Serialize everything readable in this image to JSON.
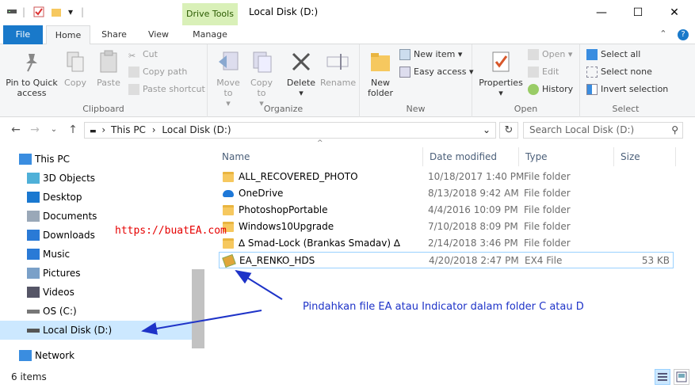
{
  "title_bar": {
    "contextual_tab": "Drive Tools",
    "window_title": "Local Disk (D:)",
    "minimize": "—",
    "maximize": "☐",
    "close": "✕"
  },
  "tabs": {
    "file": "File",
    "home": "Home",
    "share": "Share",
    "view": "View",
    "manage": "Manage"
  },
  "ribbon": {
    "clipboard": {
      "label": "Clipboard",
      "pin": "Pin to Quick access",
      "copy": "Copy",
      "paste": "Paste",
      "cut": "Cut",
      "copy_path": "Copy path",
      "paste_shortcut": "Paste shortcut"
    },
    "organize": {
      "label": "Organize",
      "move_to": "Move to",
      "copy_to": "Copy to",
      "delete": "Delete",
      "rename": "Rename"
    },
    "new": {
      "label": "New",
      "new_folder": "New folder",
      "new_item": "New item",
      "easy_access": "Easy access"
    },
    "open": {
      "label": "Open",
      "properties": "Properties",
      "open": "Open",
      "edit": "Edit",
      "history": "History"
    },
    "select": {
      "label": "Select",
      "select_all": "Select all",
      "select_none": "Select none",
      "invert_selection": "Invert selection"
    }
  },
  "address": {
    "crumbs": [
      "This PC",
      "Local Disk (D:)"
    ],
    "search_placeholder": "Search Local Disk (D:)"
  },
  "nav": {
    "items": [
      {
        "label": "This PC",
        "icon": "pc-icon"
      },
      {
        "label": "3D Objects",
        "icon": "cube-icon"
      },
      {
        "label": "Desktop",
        "icon": "desktop-icon"
      },
      {
        "label": "Documents",
        "icon": "documents-icon"
      },
      {
        "label": "Downloads",
        "icon": "downloads-icon"
      },
      {
        "label": "Music",
        "icon": "music-icon"
      },
      {
        "label": "Pictures",
        "icon": "pictures-icon"
      },
      {
        "label": "Videos",
        "icon": "videos-icon"
      },
      {
        "label": "OS (C:)",
        "icon": "drive-c-icon"
      },
      {
        "label": "Local Disk (D:)",
        "icon": "drive-d-icon"
      },
      {
        "label": "Network",
        "icon": "network-icon"
      }
    ]
  },
  "columns": {
    "name": "Name",
    "date": "Date modified",
    "type": "Type",
    "size": "Size"
  },
  "files": [
    {
      "name": "ALL_RECOVERED_PHOTO",
      "date": "10/18/2017 1:40 PM",
      "type": "File folder",
      "size": "",
      "icon": "folder-icon"
    },
    {
      "name": "OneDrive",
      "date": "8/13/2018 9:42 AM",
      "type": "File folder",
      "size": "",
      "icon": "onedrive-icon"
    },
    {
      "name": "PhotoshopPortable",
      "date": "4/4/2016 10:09 PM",
      "type": "File folder",
      "size": "",
      "icon": "folder-icon"
    },
    {
      "name": "Windows10Upgrade",
      "date": "7/10/2018 8:09 PM",
      "type": "File folder",
      "size": "",
      "icon": "folder-icon"
    },
    {
      "name": "∆ Smad-Lock (Brankas Smadav) ∆",
      "date": "2/14/2018 3:46 PM",
      "type": "File folder",
      "size": "",
      "icon": "folder-icon"
    },
    {
      "name": "EA_RENKO_HDS",
      "date": "4/20/2018 2:47 PM",
      "type": "EX4 File",
      "size": "53 KB",
      "icon": "ex4-file-icon"
    }
  ],
  "annotations": {
    "watermark": "https://buatEA.com",
    "instruction": "Pindahkan file EA atau Indicator dalam folder C atau D"
  },
  "status": {
    "count": "6 items"
  },
  "colors": {
    "accent": "#1979ca",
    "annotation": "#1e33c8",
    "watermark": "#e60000",
    "selection": "#cce8ff"
  }
}
